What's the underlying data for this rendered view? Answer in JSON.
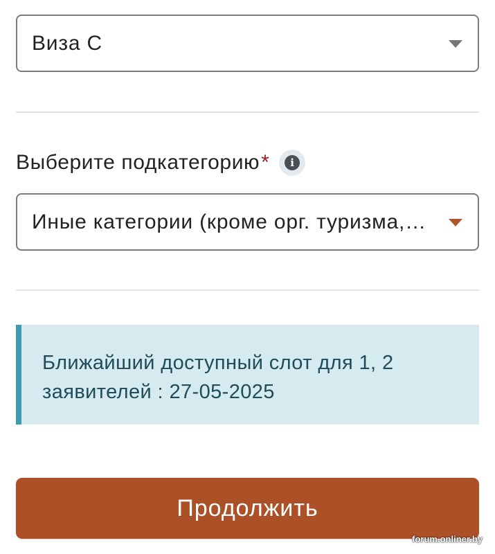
{
  "visa_select": {
    "value": "Виза C"
  },
  "subcategory": {
    "label": "Выберите подкатегорию",
    "required_marker": "*",
    "info_icon": "info-icon",
    "value": "Иные категории (кроме орг. туризма,…"
  },
  "alert": {
    "text": "Ближайший доступный слот для 1, 2 заявителей : 27-05-2025"
  },
  "continue_button": {
    "label": "Продолжить"
  },
  "watermark": {
    "text": "forum.onliner.by"
  },
  "colors": {
    "accent": "#ac5127",
    "alert_background": "#d6ebf0",
    "alert_border": "#3a9cb4",
    "alert_text": "#1f4b5a",
    "required": "#9a1d1d"
  }
}
